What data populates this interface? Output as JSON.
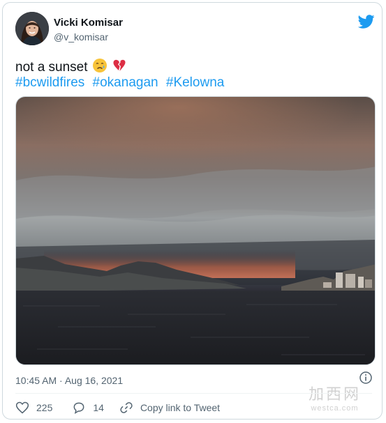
{
  "author": {
    "name": "Vicki Komisar",
    "handle": "@v_komisar"
  },
  "tweet": {
    "text": "not a sunset",
    "emoji": [
      "crying-face",
      "broken-heart"
    ],
    "hashtags": [
      "#bcwildfires",
      "#okanagan",
      "#Kelowna"
    ],
    "media_alt": "Smoke-filled sky over Okanagan Lake with mountains and city skyline"
  },
  "meta": {
    "timestamp": "10:45 AM · Aug 16, 2021"
  },
  "actions": {
    "likes": "225",
    "replies": "14",
    "copy_link": "Copy link to Tweet"
  },
  "watermark": {
    "cn": "加西网",
    "en": "westca.com"
  },
  "colors": {
    "twitter_blue": "#1d9bf0",
    "text_secondary": "#536471",
    "border": "#cfd9de"
  }
}
